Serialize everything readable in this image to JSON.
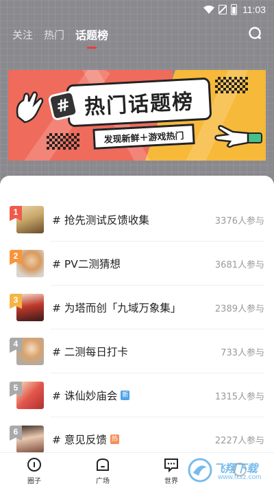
{
  "status_bar": {
    "time": "11:03"
  },
  "nav": {
    "tabs": [
      {
        "label": "关注",
        "active": false
      },
      {
        "label": "热门",
        "active": false
      },
      {
        "label": "话题榜",
        "active": true
      }
    ]
  },
  "banner": {
    "tag_symbol": "#",
    "title": "热门话题榜",
    "subtitle": "发现新鲜＋游戏热门"
  },
  "topics": [
    {
      "rank": "1",
      "title": "# 抢先测试反馈收集",
      "count": "3376人参与",
      "badge": "",
      "rank_color": "#f05a4a"
    },
    {
      "rank": "2",
      "title": "# PV二测猜想",
      "count": "3681人参与",
      "badge": "",
      "rank_color": "#f7953e"
    },
    {
      "rank": "3",
      "title": "# 为塔而创「九域万象集」",
      "count": "2389人参与",
      "badge": "",
      "rank_color": "#f4b545"
    },
    {
      "rank": "4",
      "title": "# 二测每日打卡",
      "count": "733人参与",
      "badge": "",
      "rank_color": "#a9a9a9"
    },
    {
      "rank": "5",
      "title": "# 诛仙妙庙会",
      "count": "1315人参与",
      "badge": "新",
      "badge_type": "new",
      "rank_color": "#a9a9a9"
    },
    {
      "rank": "6",
      "title": "# 意见反馈",
      "count": "2227人参与",
      "badge": "热",
      "badge_type": "hot",
      "rank_color": "#a9a9a9"
    }
  ],
  "bottom_nav": [
    {
      "label": "圈子",
      "icon": "circle-dot-icon"
    },
    {
      "label": "广场",
      "icon": "home-icon"
    },
    {
      "label": "世界",
      "icon": "chat-icon"
    },
    {
      "label": "",
      "icon": "profile-icon"
    }
  ],
  "watermark": {
    "text": "飞翔下载",
    "url": "www.fxxz.com"
  }
}
